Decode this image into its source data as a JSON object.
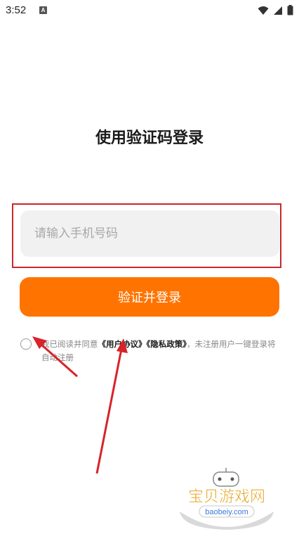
{
  "status_bar": {
    "time": "3:52",
    "notification_letter": "A"
  },
  "title": "使用验证码登录",
  "phone_input": {
    "placeholder": "请输入手机号码",
    "value": ""
  },
  "login_button": {
    "label": "验证并登录"
  },
  "agreement": {
    "prefix": "我已阅读并同意",
    "user_agreement": "《用户协议》",
    "privacy_policy": "《隐私政策》",
    "suffix": "，未注册用户一键登录将自动注册",
    "checked": false
  },
  "watermark": {
    "name": "宝贝游戏网",
    "url": "baobeiy.com"
  },
  "colors": {
    "accent": "#ff7300",
    "highlight_box": "#c8282a",
    "arrow": "#d8232a"
  }
}
